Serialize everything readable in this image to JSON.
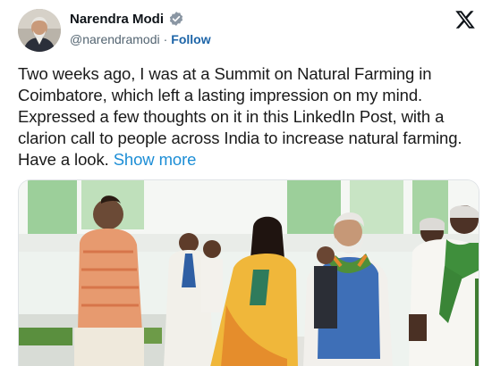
{
  "user": {
    "display_name": "Narendra Modi",
    "handle": "@narendramodi",
    "separator": "·",
    "follow_label": "Follow",
    "verified_icon": "verified-badge-icon",
    "brand_icon": "x-logo-icon"
  },
  "tweet": {
    "text": "Two weeks ago, I was at a Summit on Natural Farming in Coimbatore, which left a lasting impression on my mind. Expressed a few thoughts on it in this LinkedIn Post, with a clarion call to people across India to increase natural farming. Have a look. ",
    "show_more_label": "Show more"
  },
  "colors": {
    "follow": "#1d65a8",
    "show_more": "#1d8ed6",
    "handle": "#536471",
    "verified_badge": "#8a96a3"
  }
}
